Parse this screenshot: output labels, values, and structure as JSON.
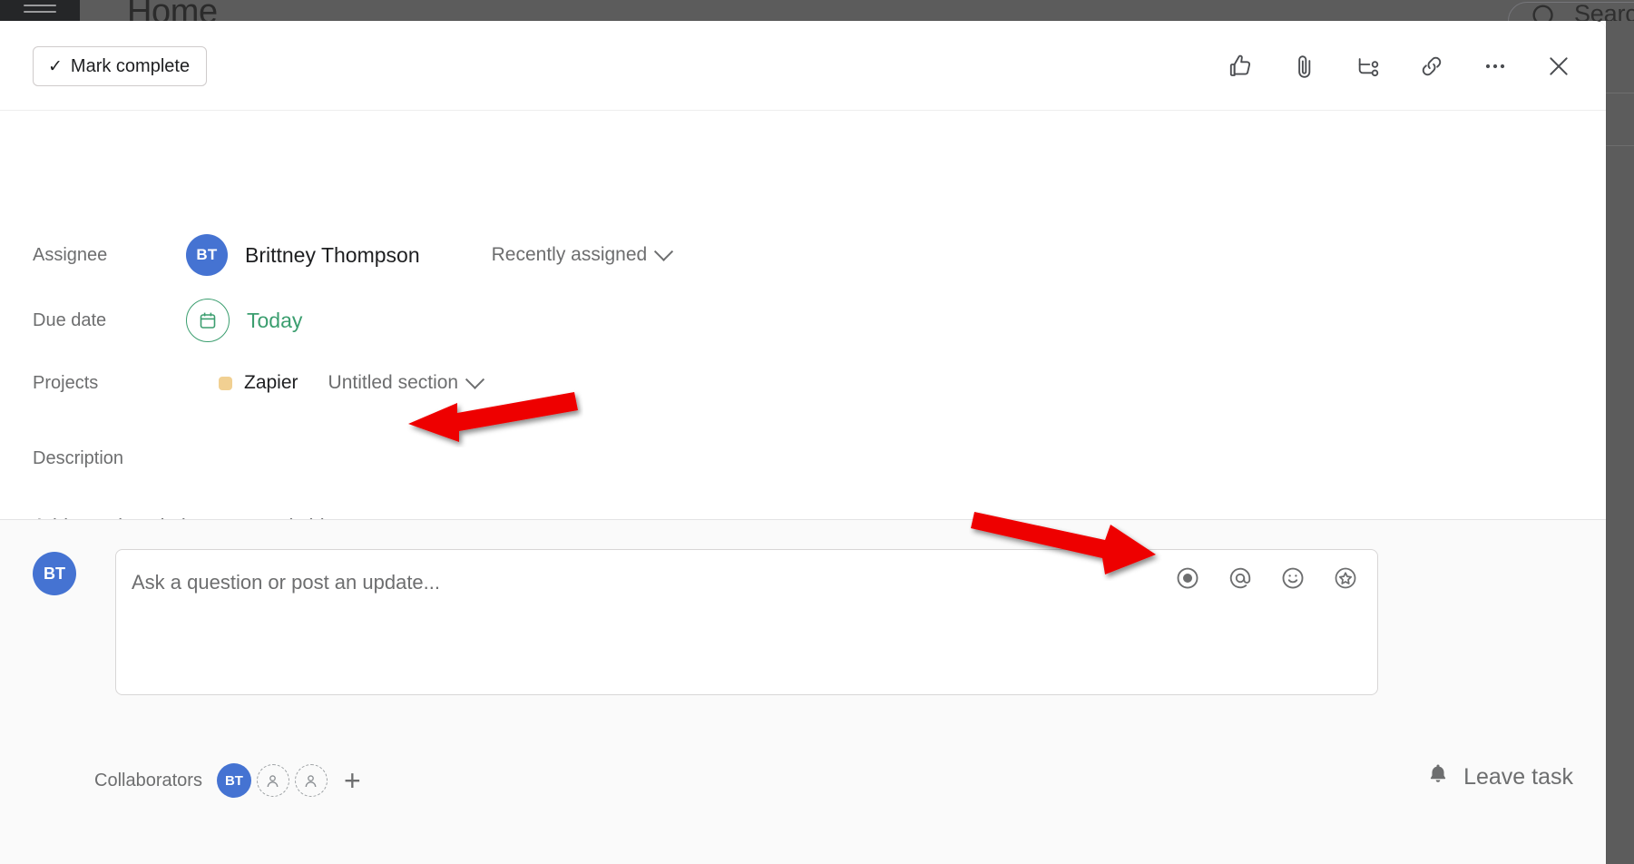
{
  "background": {
    "app_title": "Home",
    "search_label": "Searc",
    "hamburger_icon": "hamburger-menu-icon",
    "search_icon": "search-icon"
  },
  "header": {
    "mark_complete_label": "Mark complete",
    "check_glyph": "✓",
    "actions": [
      {
        "name": "like",
        "icon": "thumbs-up-icon"
      },
      {
        "name": "attach",
        "icon": "paperclip-icon"
      },
      {
        "name": "subtask",
        "icon": "subtask-branch-icon"
      },
      {
        "name": "copy-link",
        "icon": "link-icon"
      },
      {
        "name": "more",
        "icon": "ellipsis-icon"
      },
      {
        "name": "close",
        "icon": "close-icon"
      }
    ]
  },
  "fields": {
    "assignee": {
      "label": "Assignee",
      "avatar_initials": "BT",
      "name": "Brittney Thompson",
      "sub_label": "Recently assigned",
      "avatar_color": "#4573d2"
    },
    "due_date": {
      "label": "Due date",
      "value": "Today",
      "accent_color": "#3b9e6f",
      "icon": "calendar-icon"
    },
    "projects": {
      "label": "Projects",
      "project_name": "Zapier",
      "project_color": "#f1d092",
      "section_label": "Untitled section"
    },
    "description": {
      "label": "Description",
      "placeholder": "Add text description or record video"
    }
  },
  "comment": {
    "avatar_initials": "BT",
    "placeholder": "Ask a question or post an update...",
    "tools": [
      {
        "name": "record-video",
        "icon": "record-circle-icon"
      },
      {
        "name": "mention",
        "icon": "at-mention-icon"
      },
      {
        "name": "emoji",
        "icon": "smiley-icon"
      },
      {
        "name": "sticker",
        "icon": "star-circle-icon"
      }
    ]
  },
  "collaborators": {
    "label": "Collaborators",
    "avatars": [
      {
        "initials": "BT",
        "type": "filled"
      },
      {
        "initials": "",
        "type": "empty"
      },
      {
        "initials": "",
        "type": "empty"
      }
    ],
    "add_glyph": "+"
  },
  "leave_task": {
    "label": "Leave task",
    "icon": "bell-icon"
  },
  "annotations": {
    "arrow_color": "#ee0000",
    "arrow_1_target": "description-placeholder",
    "arrow_2_target": "comment-tools"
  }
}
